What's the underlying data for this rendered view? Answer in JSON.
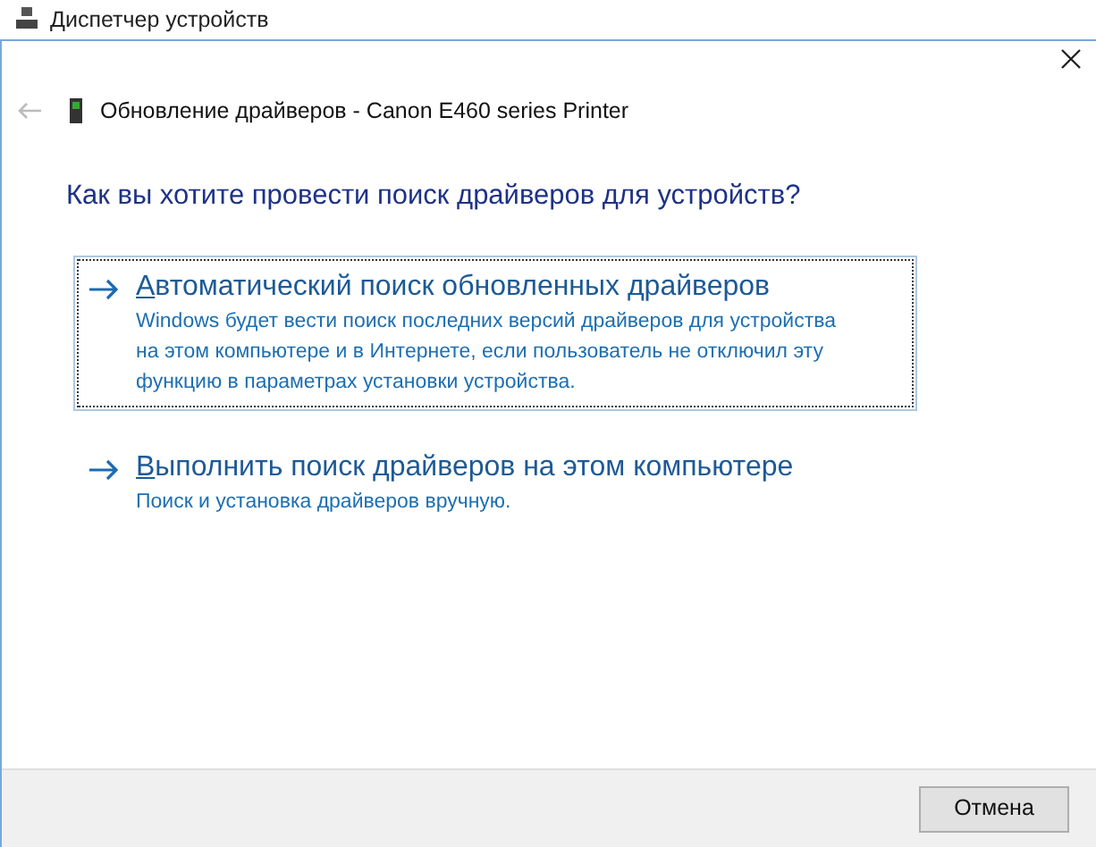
{
  "background_window": {
    "title": "Диспетчер устройств"
  },
  "dialog": {
    "title": "Обновление драйверов - Canon E460 series Printer",
    "question": "Как вы хотите провести поиск драйверов для устройств?",
    "options": [
      {
        "label": "Автоматический поиск обновленных драйверов",
        "description": "Windows будет вести поиск последних версий драйверов для устройства на этом компьютере и в Интернете, если пользователь не отключил эту функцию в параметрах установки устройства.",
        "selected": true
      },
      {
        "label": "Выполнить поиск драйверов на этом компьютере",
        "description": "Поиск и установка драйверов вручную.",
        "selected": false
      }
    ],
    "buttons": [
      "Отмена"
    ]
  }
}
